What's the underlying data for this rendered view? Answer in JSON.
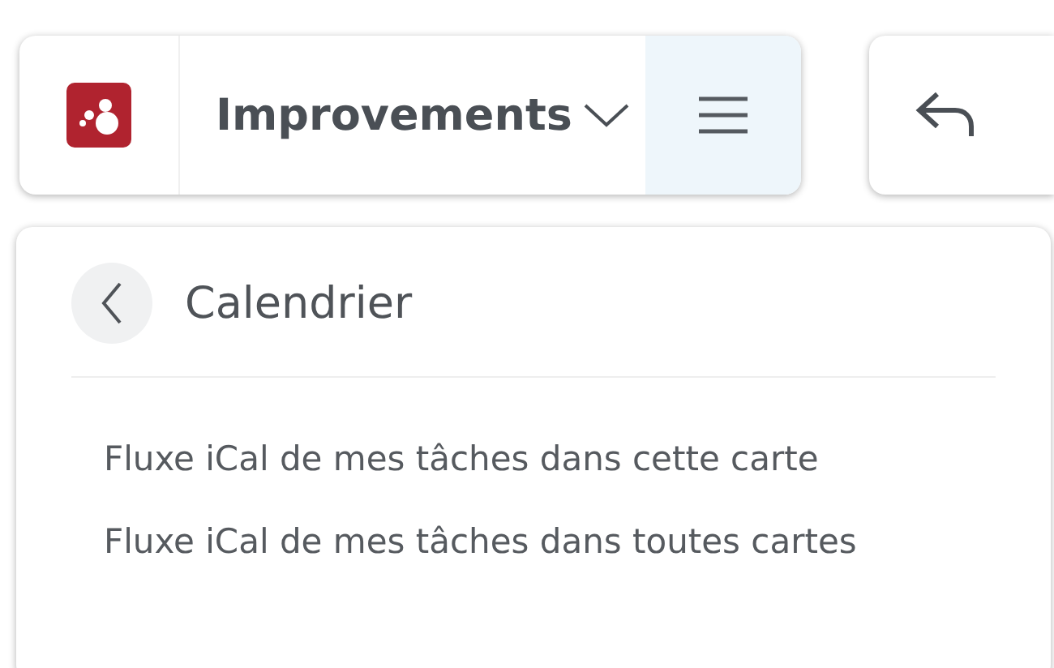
{
  "toolbar": {
    "board_title": "Improvements",
    "menu_open": true
  },
  "panel": {
    "title": "Calendrier",
    "items": [
      {
        "label": "Fluxe iCal de mes tâches dans cette carte"
      },
      {
        "label": "Fluxe iCal de mes tâches dans toutes cartes"
      }
    ]
  }
}
